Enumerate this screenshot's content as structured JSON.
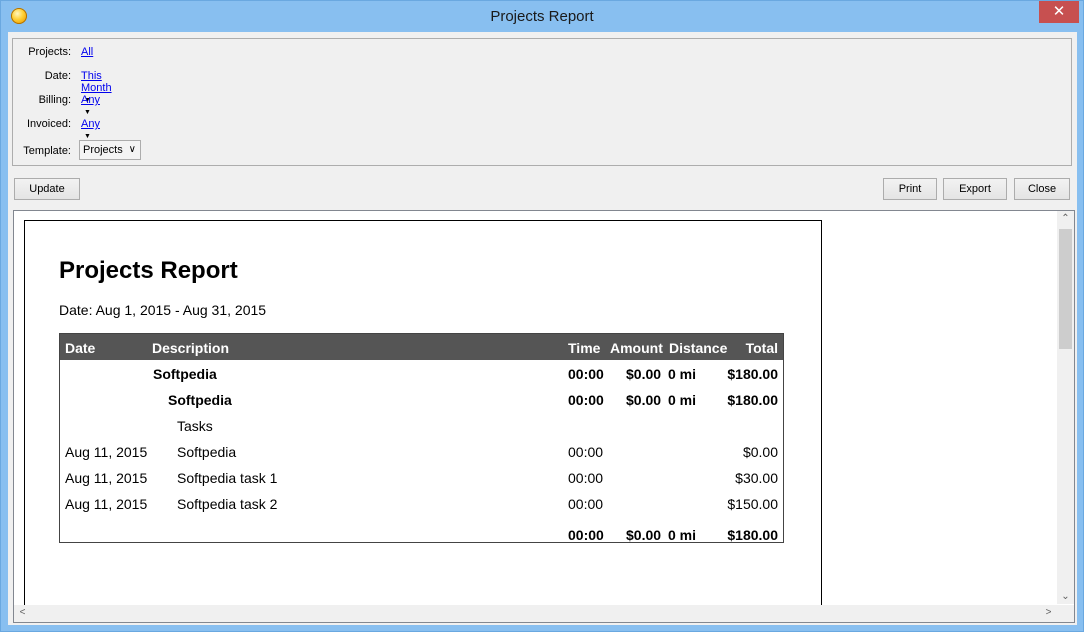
{
  "window": {
    "title": "Projects Report",
    "close_glyph": "✕"
  },
  "filters": {
    "projects": {
      "label": "Projects:",
      "value": "All"
    },
    "date": {
      "label": "Date:",
      "value": "This Month"
    },
    "billing": {
      "label": "Billing:",
      "value": "Any"
    },
    "invoiced": {
      "label": "Invoiced:",
      "value": "Any"
    },
    "template": {
      "label": "Template:",
      "value": "Projects"
    }
  },
  "toolbar": {
    "update": "Update",
    "print": "Print",
    "export": "Export",
    "close": "Close"
  },
  "report": {
    "title": "Projects Report",
    "date_range": "Date: Aug 1, 2015 - Aug 31, 2015",
    "columns": [
      "Date",
      "Description",
      "Time",
      "Amount",
      "Distance",
      "Total"
    ],
    "group": {
      "description": "Softpedia",
      "time": "00:00",
      "amount": "$0.00",
      "distance": "0 mi",
      "total": "$180.00"
    },
    "subgroup": {
      "description": "Softpedia",
      "time": "00:00",
      "amount": "$0.00",
      "distance": "0 mi",
      "total": "$180.00"
    },
    "category": "Tasks",
    "rows": [
      {
        "date": "Aug 11, 2015",
        "description": "Softpedia",
        "time": "00:00",
        "total": "$0.00"
      },
      {
        "date": "Aug 11, 2015",
        "description": "Softpedia task 1",
        "time": "00:00",
        "total": "$30.00"
      },
      {
        "date": "Aug 11, 2015",
        "description": "Softpedia task 2",
        "time": "00:00",
        "total": "$150.00"
      }
    ],
    "totals": {
      "time": "00:00",
      "amount": "$0.00",
      "distance": "0 mi",
      "total": "$180.00"
    }
  },
  "scroll": {
    "up": "⌃",
    "down": "⌄",
    "left": "<",
    "right": ">"
  }
}
